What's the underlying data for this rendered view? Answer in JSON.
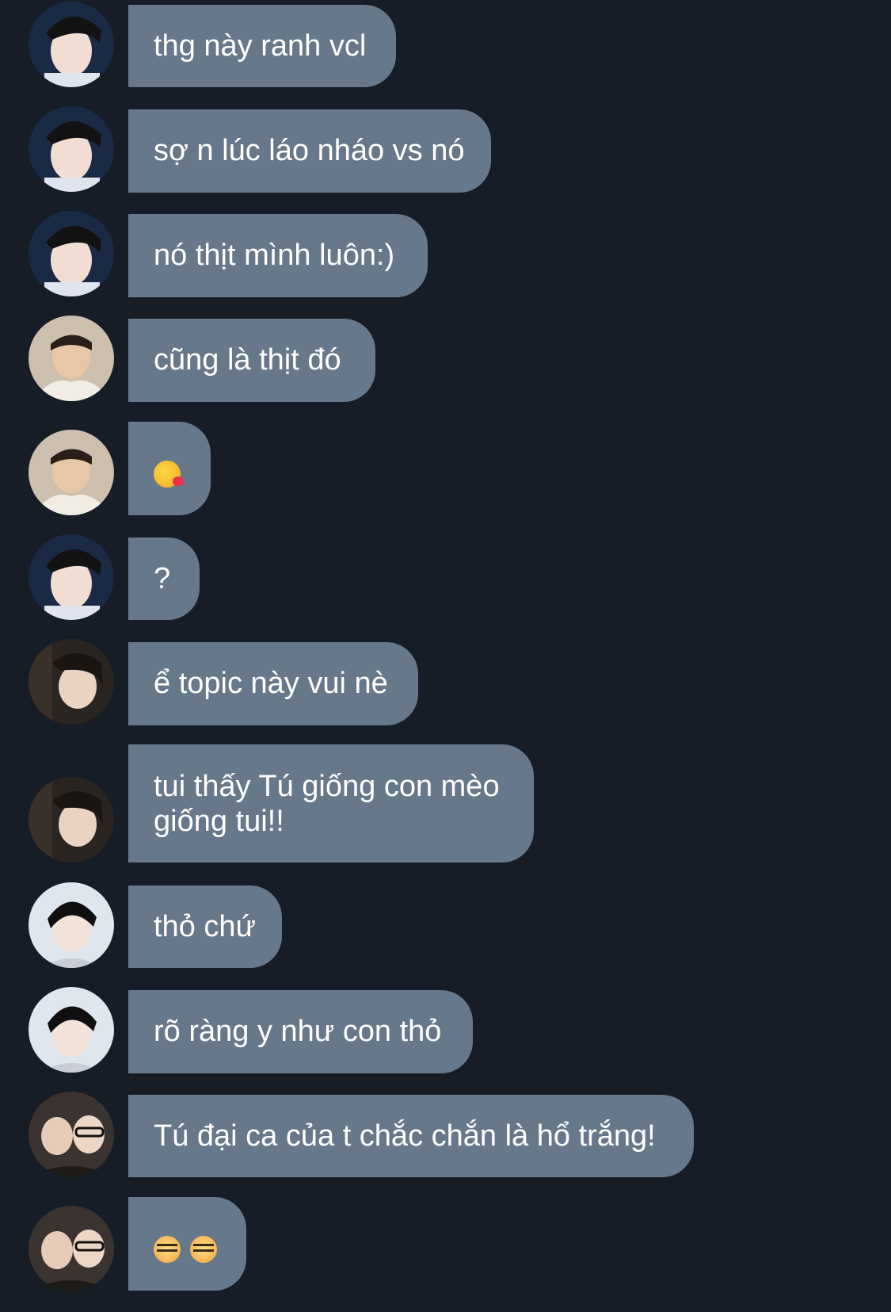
{
  "colors": {
    "background": "#161d27",
    "bubble": "#66788a",
    "text": "#ffffff"
  },
  "messages": [
    {
      "avatar": "avatar-a",
      "text": "thg này ranh vcl"
    },
    {
      "avatar": "avatar-a",
      "text": "sợ n lúc láo nháo vs nó"
    },
    {
      "avatar": "avatar-a",
      "text": "nó thịt mình luôn:)"
    },
    {
      "avatar": "avatar-b",
      "text": "cũng là thịt đó"
    },
    {
      "avatar": "avatar-b",
      "emoji": "kissing-face-emoji"
    },
    {
      "avatar": "avatar-a",
      "text": "?"
    },
    {
      "avatar": "avatar-c",
      "text": "ể topic này vui nè"
    },
    {
      "avatar": "avatar-c",
      "text": "tui thấy Tú giống con mèo giống tui!!"
    },
    {
      "avatar": "avatar-d",
      "text": "thỏ chứ"
    },
    {
      "avatar": "avatar-d",
      "text": "rõ ràng y như con thỏ"
    },
    {
      "avatar": "avatar-e",
      "text": "Tú đại ca của t chắc chắn là hổ trắng!"
    },
    {
      "avatar": "avatar-e",
      "emoji": "tiger-face-emoji tiger-face-emoji"
    }
  ]
}
